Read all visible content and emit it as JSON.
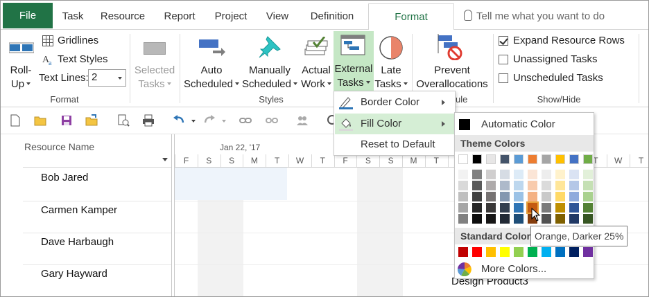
{
  "tabs": [
    "File",
    "Task",
    "Resource",
    "Report",
    "Project",
    "View",
    "Definition",
    "Format"
  ],
  "active_tab": "Format",
  "tell_me": "Tell me what you want to do",
  "ribbon": {
    "format_group": {
      "label": "Format",
      "rollup_line1": "Roll-",
      "rollup_line2": "Up",
      "gridlines": "Gridlines",
      "text_styles": "Text Styles",
      "text_lines_label": "Text Lines:",
      "text_lines_value": "2"
    },
    "selected_tasks_line1": "Selected",
    "selected_tasks_line2": "Tasks",
    "styles_group": {
      "label": "Styles",
      "auto_scheduled_line1": "Auto",
      "auto_scheduled_line2": "Scheduled",
      "manually_scheduled_line1": "Manually",
      "manually_scheduled_line2": "Scheduled",
      "actual_work_line1": "Actual",
      "actual_work_line2": "Work",
      "external_tasks_line1": "External",
      "external_tasks_line2": "Tasks",
      "late_tasks_line1": "Late",
      "late_tasks_line2": "Tasks"
    },
    "schedule_group": {
      "label_fragment": "ule",
      "prevent_line1": "Prevent",
      "prevent_line2": "Overallocations"
    },
    "showhide_group": {
      "label": "Show/Hide",
      "expand_rows": "Expand Resource Rows",
      "expand_checked": true,
      "unassigned": "Unassigned Tasks",
      "unassigned_checked": false,
      "unscheduled": "Unscheduled Tasks",
      "unscheduled_checked": false
    }
  },
  "grid": {
    "column_header": "Resource Name",
    "resources": [
      "Bob Jared",
      "Carmen Kamper",
      "Dave Harbaugh",
      "Gary Hayward"
    ],
    "timeline_date": "Jan 22, '17",
    "days": [
      "F",
      "S",
      "S",
      "M",
      "T",
      "W",
      "T",
      "F",
      "S",
      "S",
      "M",
      "T",
      "W",
      "T",
      "F",
      "S",
      "S",
      "M",
      "T",
      "W",
      "T"
    ],
    "bar_label": "Design Product3"
  },
  "menu": {
    "items": [
      "Border Color",
      "Fill Color",
      "Reset to Default"
    ],
    "highlighted": "Fill Color"
  },
  "palette": {
    "automatic": "Automatic Color",
    "theme_header": "Theme Colors",
    "theme_top": [
      "#ffffff",
      "#000000",
      "#e7e6e6",
      "#44546a",
      "#5b9bd5",
      "#ed7d31",
      "#a5a5a5",
      "#ffc000",
      "#4472c4",
      "#70ad47"
    ],
    "theme_shades": [
      [
        "#f2f2f2",
        "#d9d9d9",
        "#bfbfbf",
        "#a6a6a6",
        "#808080"
      ],
      [
        "#808080",
        "#595959",
        "#404040",
        "#262626",
        "#0d0d0d"
      ],
      [
        "#d0cece",
        "#aeaaaa",
        "#757171",
        "#3a3838",
        "#171616"
      ],
      [
        "#d6dce4",
        "#adb9ca",
        "#8497b0",
        "#333f4f",
        "#222a35"
      ],
      [
        "#ddebf7",
        "#bdd7ee",
        "#9bc2e6",
        "#2e75b6",
        "#1f4e78"
      ],
      [
        "#fbe5d6",
        "#f8cbad",
        "#f4b183",
        "#c55a11",
        "#843c0c"
      ],
      [
        "#ededed",
        "#dbdbdb",
        "#c9c9c9",
        "#7b7b7b",
        "#525252"
      ],
      [
        "#fff2cc",
        "#ffe699",
        "#ffd966",
        "#bf8f00",
        "#7f6000"
      ],
      [
        "#dae3f3",
        "#b4c7e7",
        "#8faadc",
        "#2f5597",
        "#203864"
      ],
      [
        "#e2f0d9",
        "#c5e0b4",
        "#a9d18e",
        "#548235",
        "#375623"
      ]
    ],
    "standard_header": "Standard Colors",
    "standard": [
      "#c00000",
      "#ff0000",
      "#ffc000",
      "#ffff00",
      "#92d050",
      "#00b050",
      "#00b0f0",
      "#0070c0",
      "#002060",
      "#7030a0"
    ],
    "more_colors": "More Colors...",
    "tooltip": "Orange, Darker 25%"
  }
}
